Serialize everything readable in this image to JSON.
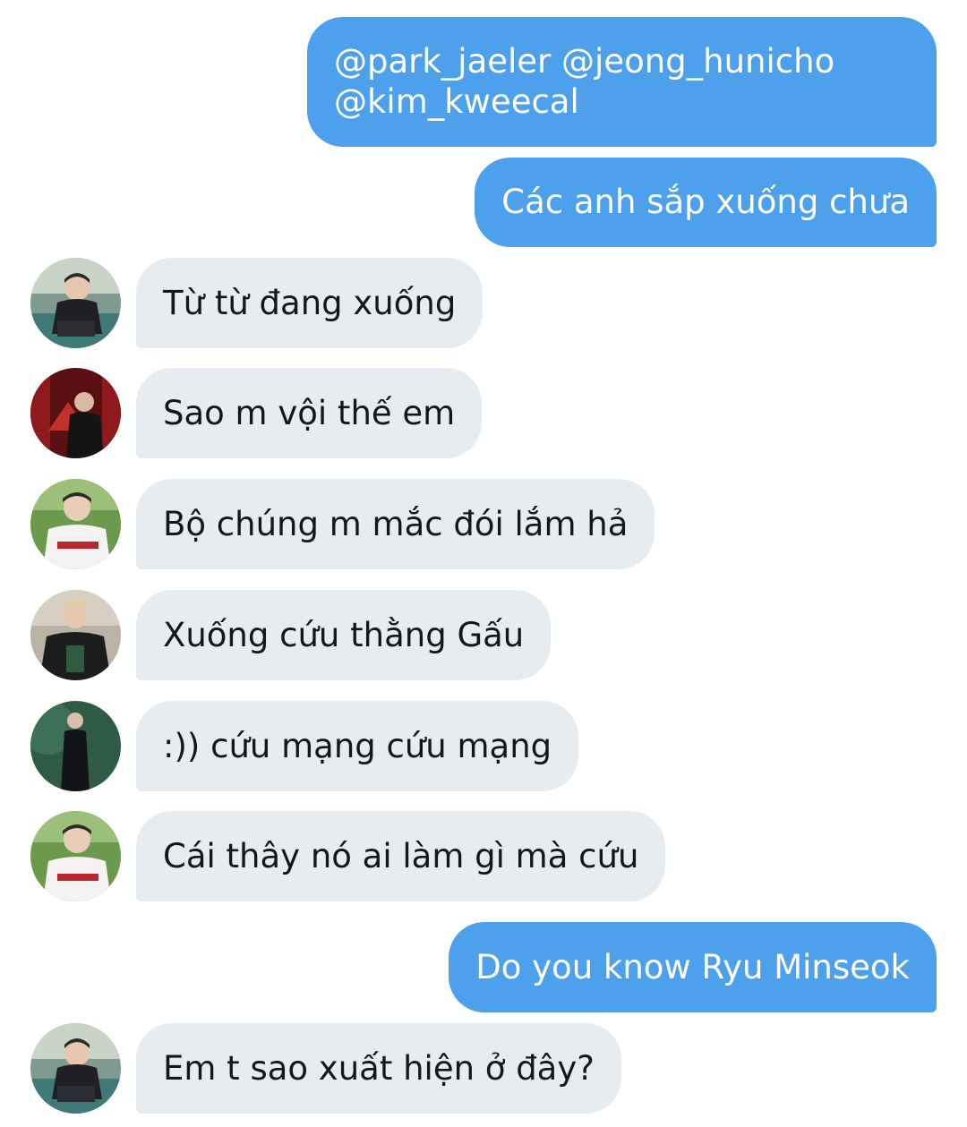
{
  "conversation": {
    "messages": [
      {
        "id": "m1",
        "direction": "sent",
        "lines": [
          "@park_jaeler @jeong_hunicho",
          "@kim_kweecal"
        ]
      },
      {
        "id": "m2",
        "direction": "sent",
        "text": "Các anh sắp xuống chưa"
      },
      {
        "id": "m3",
        "direction": "received",
        "avatar": "avatar-user-a",
        "text": "Từ từ đang xuống"
      },
      {
        "id": "m4",
        "direction": "received",
        "avatar": "avatar-user-b",
        "text": "Sao m vội thế em"
      },
      {
        "id": "m5",
        "direction": "received",
        "avatar": "avatar-user-c",
        "text": "Bộ chúng m mắc đói lắm hả"
      },
      {
        "id": "m6",
        "direction": "received",
        "avatar": "avatar-user-d",
        "text": "Xuống cứu thằng Gấu"
      },
      {
        "id": "m7",
        "direction": "received",
        "avatar": "avatar-user-e",
        "text": ":)) cứu mạng cứu mạng"
      },
      {
        "id": "m8",
        "direction": "received",
        "avatar": "avatar-user-c",
        "text": "Cái thây nó ai làm gì mà cứu"
      },
      {
        "id": "m9",
        "direction": "sent",
        "text": "Do you know Ryu Minseok"
      },
      {
        "id": "m10",
        "direction": "received",
        "avatar": "avatar-user-a",
        "text": "Em t sao xuất hiện ở đây?"
      }
    ]
  },
  "colors": {
    "sent_bubble": "#4da0eb",
    "received_bubble": "#e6ecf0",
    "sent_text": "#ffffff",
    "received_text": "#14171a"
  }
}
